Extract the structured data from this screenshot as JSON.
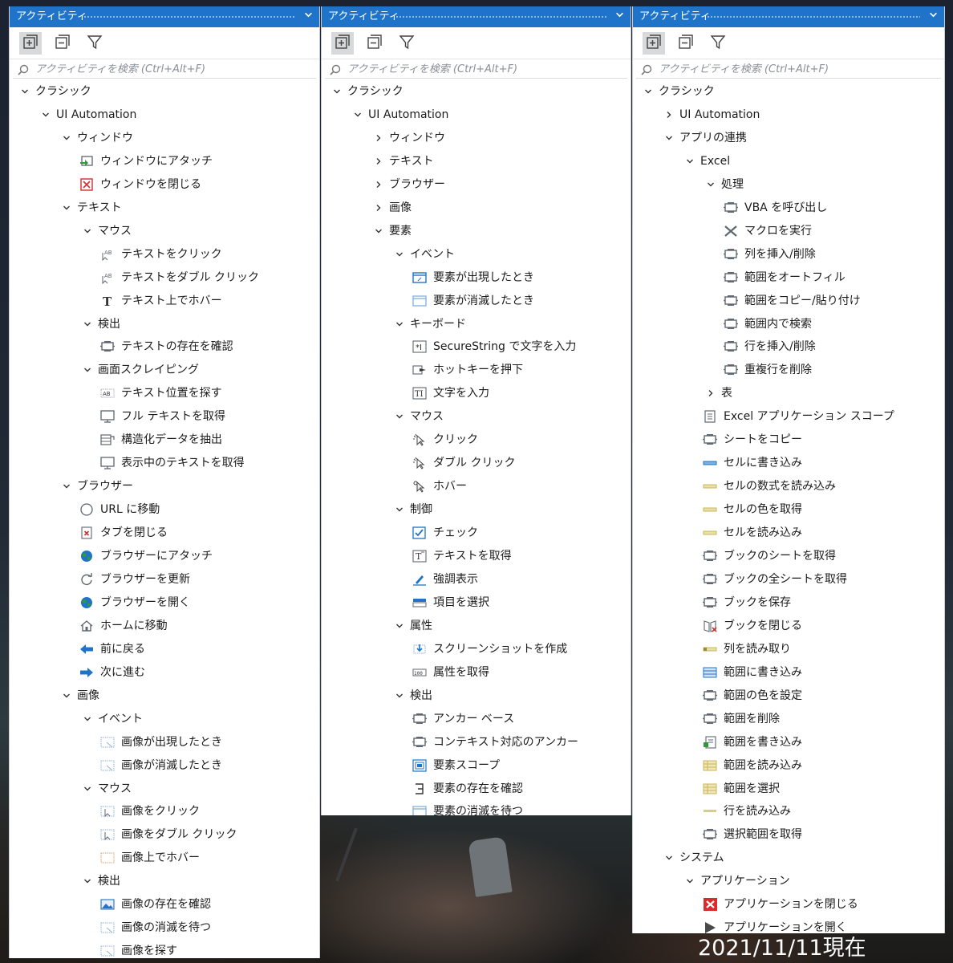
{
  "window_title": "アクティビティ",
  "search_placeholder": "アクティビティを検索 (Ctrl+Alt+F)",
  "footer_date": "2021/11/11現在",
  "colors": {
    "titlebar": "#1f74c9",
    "icon_gray": "#5f6770",
    "icon_blue": "#1f74c9",
    "icon_red": "#d82c2c"
  },
  "panels": [
    {
      "rows": [
        {
          "d": 0,
          "t": "e",
          "label": "クラシック"
        },
        {
          "d": 1,
          "t": "e",
          "label": "UI Automation"
        },
        {
          "d": 2,
          "t": "e",
          "label": "ウィンドウ"
        },
        {
          "d": 3,
          "t": "l",
          "icon": "window-attach-icon",
          "label": "ウィンドウにアタッチ"
        },
        {
          "d": 3,
          "t": "l",
          "icon": "window-close-icon",
          "label": "ウィンドウを閉じる"
        },
        {
          "d": 2,
          "t": "e",
          "label": "テキスト"
        },
        {
          "d": 3,
          "t": "e",
          "label": "マウス"
        },
        {
          "d": 4,
          "t": "l",
          "icon": "text-click-icon",
          "label": "テキストをクリック"
        },
        {
          "d": 4,
          "t": "l",
          "icon": "text-click-icon",
          "label": "テキストをダブル クリック"
        },
        {
          "d": 4,
          "t": "l",
          "icon": "text-hover-icon",
          "label": "テキスト上でホバー"
        },
        {
          "d": 3,
          "t": "e",
          "label": "検出"
        },
        {
          "d": 4,
          "t": "l",
          "icon": "activity-icon",
          "label": "テキストの存在を確認"
        },
        {
          "d": 3,
          "t": "e",
          "label": "画面スクレイピング"
        },
        {
          "d": 4,
          "t": "l",
          "icon": "text-find-icon",
          "label": "テキスト位置を探す"
        },
        {
          "d": 4,
          "t": "l",
          "icon": "monitor-icon",
          "label": "フル テキストを取得"
        },
        {
          "d": 4,
          "t": "l",
          "icon": "data-extract-icon",
          "label": "構造化データを抽出"
        },
        {
          "d": 4,
          "t": "l",
          "icon": "monitor-icon",
          "label": "表示中のテキストを取得"
        },
        {
          "d": 2,
          "t": "e",
          "label": "ブラウザー"
        },
        {
          "d": 3,
          "t": "l",
          "icon": "compass-icon",
          "label": "URL に移動"
        },
        {
          "d": 3,
          "t": "l",
          "icon": "tab-close-icon",
          "label": "タブを閉じる"
        },
        {
          "d": 3,
          "t": "l",
          "icon": "globe-icon",
          "label": "ブラウザーにアタッチ"
        },
        {
          "d": 3,
          "t": "l",
          "icon": "refresh-icon",
          "label": "ブラウザーを更新"
        },
        {
          "d": 3,
          "t": "l",
          "icon": "globe-icon",
          "label": "ブラウザーを開く"
        },
        {
          "d": 3,
          "t": "l",
          "icon": "home-icon",
          "label": "ホームに移動"
        },
        {
          "d": 3,
          "t": "l",
          "icon": "arrow-left-icon",
          "label": "前に戻る"
        },
        {
          "d": 3,
          "t": "l",
          "icon": "arrow-right-icon",
          "label": "次に進む"
        },
        {
          "d": 2,
          "t": "e",
          "label": "画像"
        },
        {
          "d": 3,
          "t": "e",
          "label": "イベント"
        },
        {
          "d": 4,
          "t": "l",
          "icon": "image-dotted-icon",
          "label": "画像が出現したとき"
        },
        {
          "d": 4,
          "t": "l",
          "icon": "image-dotted-icon",
          "label": "画像が消滅したとき"
        },
        {
          "d": 3,
          "t": "e",
          "label": "マウス"
        },
        {
          "d": 4,
          "t": "l",
          "icon": "image-click-icon",
          "label": "画像をクリック"
        },
        {
          "d": 4,
          "t": "l",
          "icon": "image-click-icon",
          "label": "画像をダブル クリック"
        },
        {
          "d": 4,
          "t": "l",
          "icon": "image-hover-icon",
          "label": "画像上でホバー"
        },
        {
          "d": 3,
          "t": "e",
          "label": "検出"
        },
        {
          "d": 4,
          "t": "l",
          "icon": "image-icon",
          "label": "画像の存在を確認"
        },
        {
          "d": 4,
          "t": "l",
          "icon": "image-dotted-icon",
          "label": "画像の消滅を待つ"
        },
        {
          "d": 4,
          "t": "l",
          "icon": "image-dotted-icon",
          "label": "画像を探す"
        }
      ]
    },
    {
      "rows": [
        {
          "d": 0,
          "t": "e",
          "label": "クラシック"
        },
        {
          "d": 1,
          "t": "e",
          "label": "UI Automation"
        },
        {
          "d": 2,
          "t": "c",
          "label": "ウィンドウ"
        },
        {
          "d": 2,
          "t": "c",
          "label": "テキスト"
        },
        {
          "d": 2,
          "t": "c",
          "label": "ブラウザー"
        },
        {
          "d": 2,
          "t": "c",
          "label": "画像"
        },
        {
          "d": 2,
          "t": "e",
          "label": "要素"
        },
        {
          "d": 3,
          "t": "e",
          "label": "イベント"
        },
        {
          "d": 4,
          "t": "l",
          "icon": "element-appear-icon",
          "label": "要素が出現したとき"
        },
        {
          "d": 4,
          "t": "l",
          "icon": "element-vanish-icon",
          "label": "要素が消滅したとき"
        },
        {
          "d": 3,
          "t": "e",
          "label": "キーボード"
        },
        {
          "d": 4,
          "t": "l",
          "icon": "secure-string-icon",
          "label": "SecureString で文字を入力"
        },
        {
          "d": 4,
          "t": "l",
          "icon": "hotkey-icon",
          "label": "ホットキーを押下"
        },
        {
          "d": 4,
          "t": "l",
          "icon": "type-into-icon",
          "label": "文字を入力"
        },
        {
          "d": 3,
          "t": "e",
          "label": "マウス"
        },
        {
          "d": 4,
          "t": "l",
          "icon": "cursor-click-icon",
          "label": "クリック"
        },
        {
          "d": 4,
          "t": "l",
          "icon": "cursor-click-icon",
          "label": "ダブル クリック"
        },
        {
          "d": 4,
          "t": "l",
          "icon": "cursor-hover-icon",
          "label": "ホバー"
        },
        {
          "d": 3,
          "t": "e",
          "label": "制御"
        },
        {
          "d": 4,
          "t": "l",
          "icon": "check-icon",
          "label": "チェック"
        },
        {
          "d": 4,
          "t": "l",
          "icon": "get-text-icon",
          "label": "テキストを取得"
        },
        {
          "d": 4,
          "t": "l",
          "icon": "highlight-icon",
          "label": "強調表示"
        },
        {
          "d": 4,
          "t": "l",
          "icon": "select-item-icon",
          "label": "項目を選択"
        },
        {
          "d": 3,
          "t": "e",
          "label": "属性"
        },
        {
          "d": 4,
          "t": "l",
          "icon": "screenshot-icon",
          "label": "スクリーンショットを作成"
        },
        {
          "d": 4,
          "t": "l",
          "icon": "attribute-icon",
          "label": "属性を取得"
        },
        {
          "d": 3,
          "t": "e",
          "label": "検出"
        },
        {
          "d": 4,
          "t": "l",
          "icon": "activity-icon",
          "label": "アンカー ベース"
        },
        {
          "d": 4,
          "t": "l",
          "icon": "activity-icon",
          "label": "コンテキスト対応のアンカー"
        },
        {
          "d": 4,
          "t": "l",
          "icon": "element-scope-icon",
          "label": "要素スコープ"
        },
        {
          "d": 4,
          "t": "l",
          "icon": "element-exists-icon",
          "label": "要素の存在を確認"
        },
        {
          "d": 4,
          "t": "l",
          "icon": "element-vanish-icon",
          "label": "要素の消滅を待つ"
        }
      ]
    },
    {
      "rows": [
        {
          "d": 0,
          "t": "e",
          "label": "クラシック"
        },
        {
          "d": 1,
          "t": "c",
          "label": "UI Automation"
        },
        {
          "d": 1,
          "t": "e",
          "label": "アプリの連携"
        },
        {
          "d": 2,
          "t": "e",
          "label": "Excel"
        },
        {
          "d": 3,
          "t": "e",
          "label": "処理"
        },
        {
          "d": 4,
          "t": "l",
          "icon": "activity-icon",
          "label": "VBA を呼び出し"
        },
        {
          "d": 4,
          "t": "l",
          "icon": "macro-icon",
          "label": "マクロを実行"
        },
        {
          "d": 4,
          "t": "l",
          "icon": "activity-icon",
          "label": "列を挿入/削除"
        },
        {
          "d": 4,
          "t": "l",
          "icon": "activity-icon",
          "label": "範囲をオートフィル"
        },
        {
          "d": 4,
          "t": "l",
          "icon": "activity-icon",
          "label": "範囲をコピー/貼り付け"
        },
        {
          "d": 4,
          "t": "l",
          "icon": "activity-icon",
          "label": "範囲内で検索"
        },
        {
          "d": 4,
          "t": "l",
          "icon": "activity-icon",
          "label": "行を挿入/削除"
        },
        {
          "d": 4,
          "t": "l",
          "icon": "activity-icon",
          "label": "重複行を削除"
        },
        {
          "d": 3,
          "t": "c",
          "label": "表"
        },
        {
          "d": 3,
          "t": "l",
          "icon": "excel-scope-icon",
          "label": "Excel アプリケーション スコープ"
        },
        {
          "d": 3,
          "t": "l",
          "icon": "activity-icon",
          "label": "シートをコピー"
        },
        {
          "d": 3,
          "t": "l",
          "icon": "cell-write-icon",
          "label": "セルに書き込み"
        },
        {
          "d": 3,
          "t": "l",
          "icon": "cell-read-icon",
          "label": "セルの数式を読み込み"
        },
        {
          "d": 3,
          "t": "l",
          "icon": "cell-read-icon",
          "label": "セルの色を取得"
        },
        {
          "d": 3,
          "t": "l",
          "icon": "cell-read-icon",
          "label": "セルを読み込み"
        },
        {
          "d": 3,
          "t": "l",
          "icon": "activity-icon",
          "label": "ブックのシートを取得"
        },
        {
          "d": 3,
          "t": "l",
          "icon": "activity-icon",
          "label": "ブックの全シートを取得"
        },
        {
          "d": 3,
          "t": "l",
          "icon": "activity-icon",
          "label": "ブックを保存"
        },
        {
          "d": 3,
          "t": "l",
          "icon": "book-close-icon",
          "label": "ブックを閉じる"
        },
        {
          "d": 3,
          "t": "l",
          "icon": "column-read-icon",
          "label": "列を読み取り"
        },
        {
          "d": 3,
          "t": "l",
          "icon": "range-write-icon",
          "label": "範囲に書き込み"
        },
        {
          "d": 3,
          "t": "l",
          "icon": "activity-icon",
          "label": "範囲の色を設定"
        },
        {
          "d": 3,
          "t": "l",
          "icon": "activity-icon",
          "label": "範囲を削除"
        },
        {
          "d": 3,
          "t": "l",
          "icon": "range-append-icon",
          "label": "範囲を書き込み"
        },
        {
          "d": 3,
          "t": "l",
          "icon": "range-read-icon",
          "label": "範囲を読み込み"
        },
        {
          "d": 3,
          "t": "l",
          "icon": "range-read-icon",
          "label": "範囲を選択"
        },
        {
          "d": 3,
          "t": "l",
          "icon": "row-read-icon",
          "label": "行を読み込み"
        },
        {
          "d": 3,
          "t": "l",
          "icon": "activity-icon",
          "label": "選択範囲を取得"
        },
        {
          "d": 1,
          "t": "e",
          "label": "システム"
        },
        {
          "d": 2,
          "t": "e",
          "label": "アプリケーション"
        },
        {
          "d": 3,
          "t": "l",
          "icon": "app-close-icon",
          "label": "アプリケーションを閉じる"
        },
        {
          "d": 3,
          "t": "l",
          "icon": "app-open-icon",
          "label": "アプリケーションを開く"
        }
      ]
    }
  ]
}
